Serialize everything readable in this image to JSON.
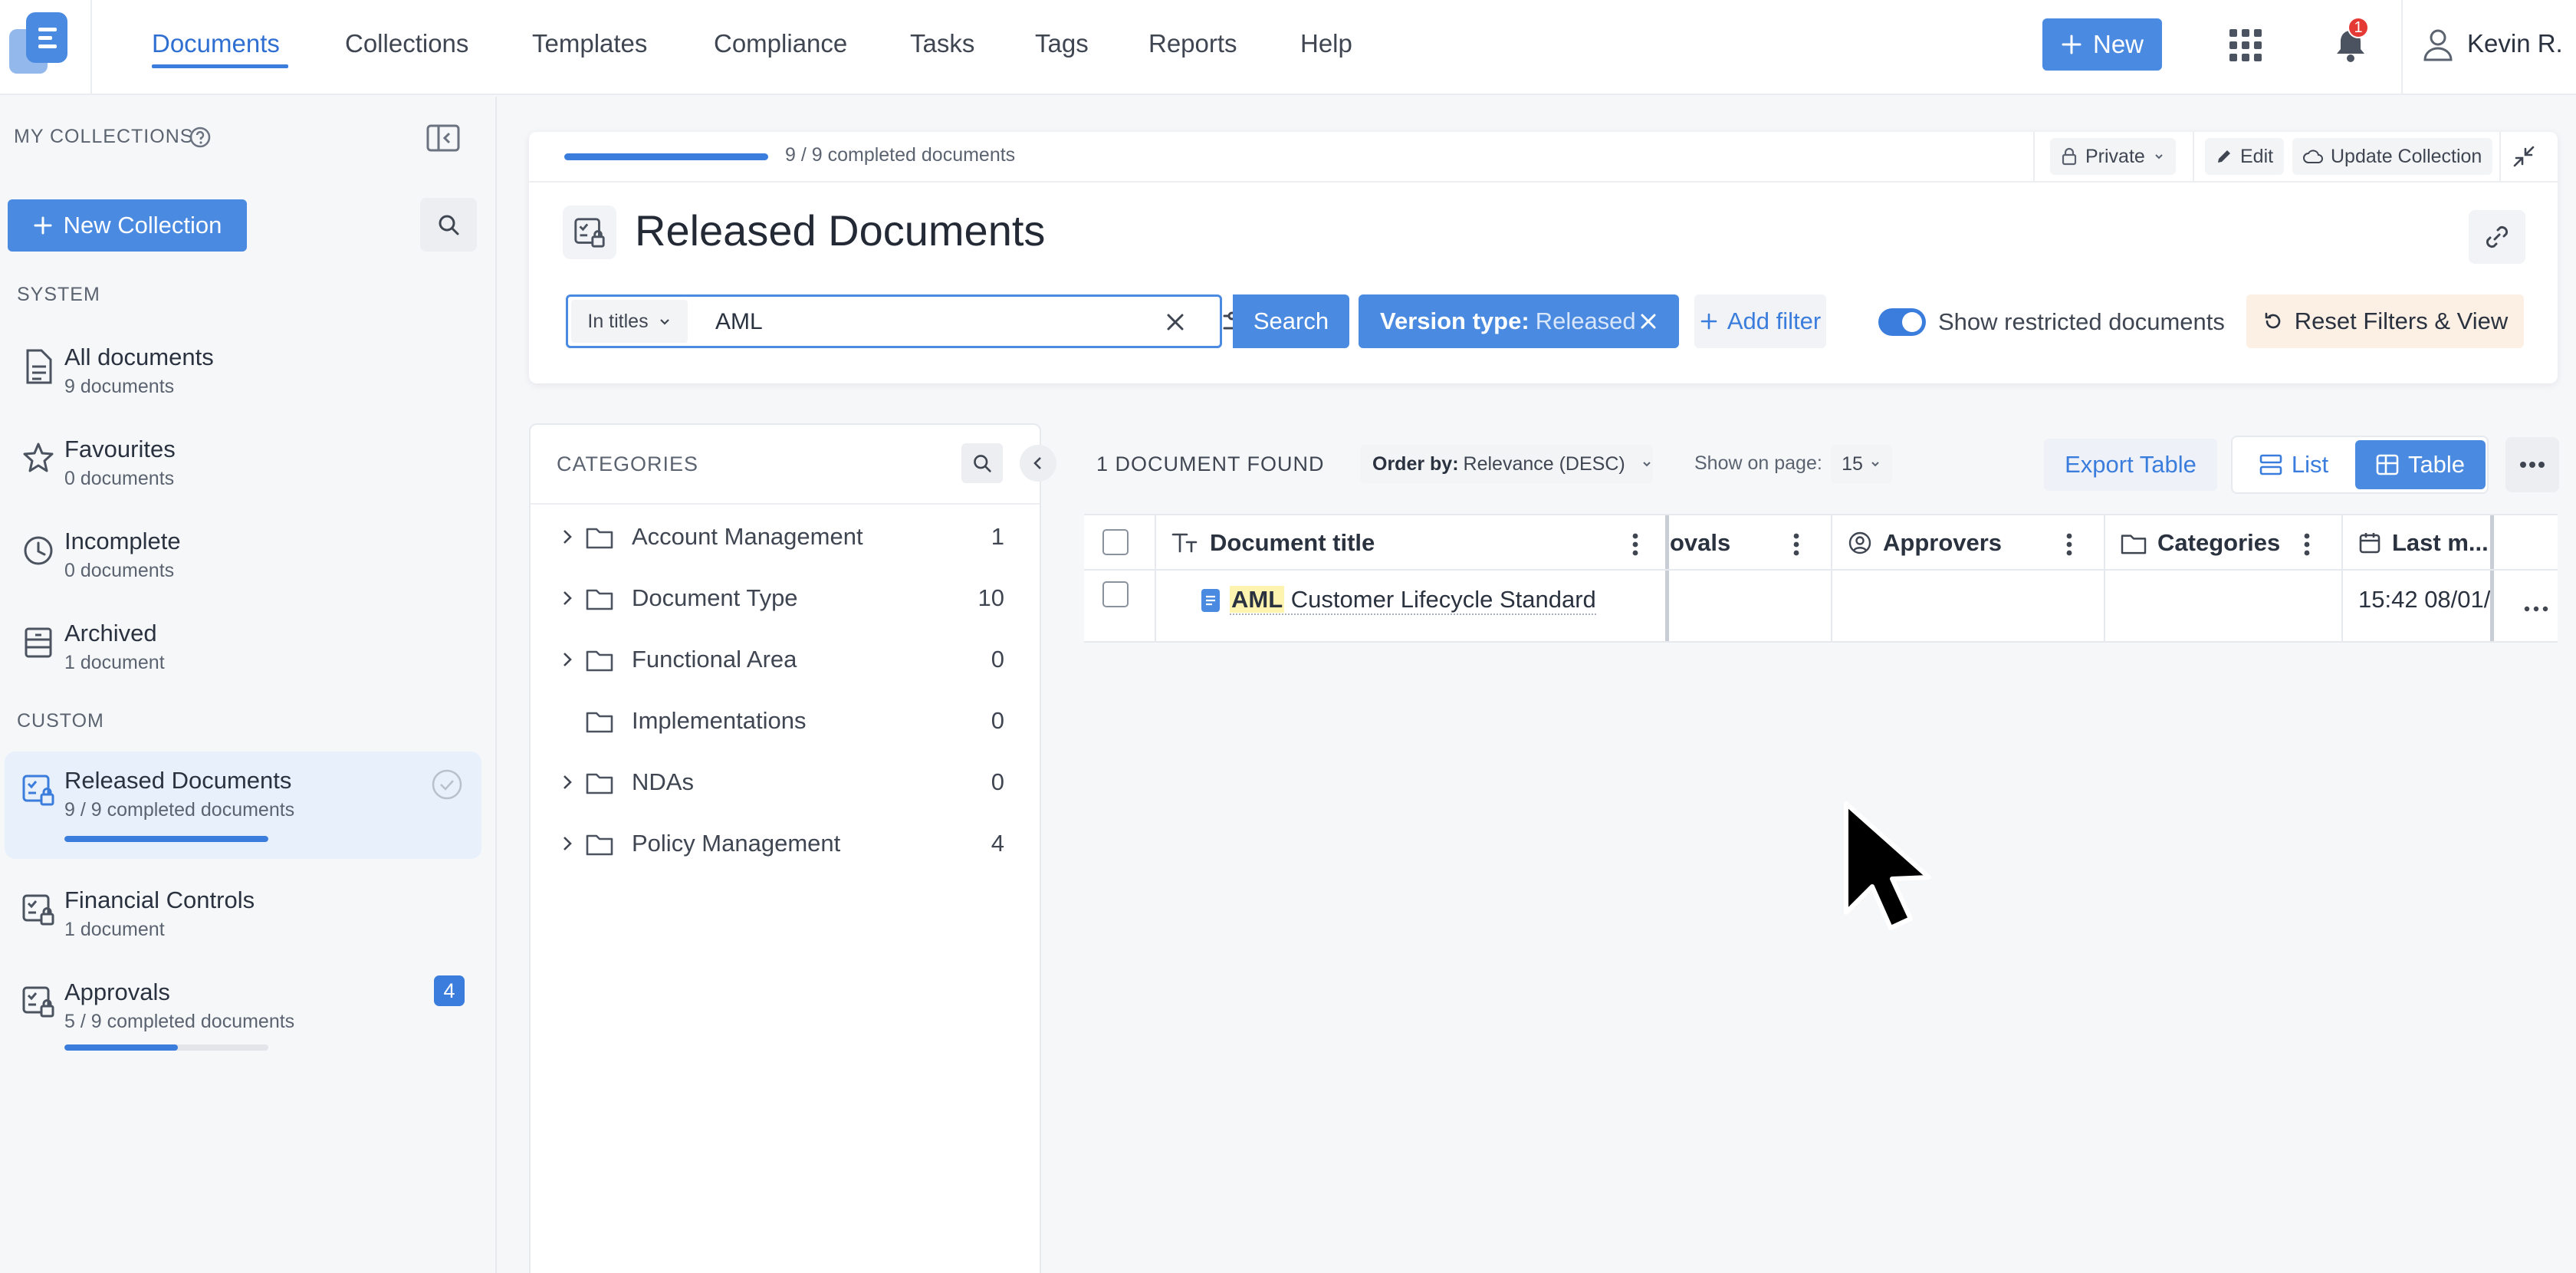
{
  "topbar": {
    "nav": [
      "Documents",
      "Collections",
      "Templates",
      "Compliance",
      "Tasks",
      "Tags",
      "Reports",
      "Help"
    ],
    "active_nav": "Documents",
    "new_label": "New",
    "notification_count": "1",
    "user_name": "Kevin R."
  },
  "sidebar": {
    "my_collections_label": "MY COLLECTIONS",
    "new_collection_label": "New Collection",
    "system_label": "SYSTEM",
    "custom_label": "CUSTOM",
    "system_items": [
      {
        "title": "All documents",
        "sub": "9 documents",
        "icon": "document-icon"
      },
      {
        "title": "Favourites",
        "sub": "0 documents",
        "icon": "star-icon"
      },
      {
        "title": "Incomplete",
        "sub": "0 documents",
        "icon": "clock-icon"
      },
      {
        "title": "Archived",
        "sub": "1 document",
        "icon": "archive-icon"
      }
    ],
    "custom_items": [
      {
        "title": "Released Documents",
        "sub": "9 / 9 completed documents",
        "progress": 1.0,
        "active": true
      },
      {
        "title": "Financial Controls",
        "sub": "1 document"
      },
      {
        "title": "Approvals",
        "sub": "5 / 9 completed documents",
        "progress": 0.5556,
        "badge": "4"
      }
    ]
  },
  "header": {
    "progress_text": "9 / 9  completed documents",
    "progress": 1.0,
    "privacy_label": "Private",
    "edit_label": "Edit",
    "update_label": "Update Collection",
    "title": "Released Documents"
  },
  "search": {
    "scope": "In titles",
    "query": "AML",
    "button_label": "Search",
    "filter_key": "Version type:",
    "filter_value": "Released",
    "add_filter_label": "Add filter",
    "toggle_label": "Show restricted documents",
    "toggle_on": true,
    "reset_label": "Reset Filters & View"
  },
  "categories": {
    "heading": "CATEGORIES",
    "items": [
      {
        "name": "Account Management",
        "count": "1",
        "expandable": true
      },
      {
        "name": "Document Type",
        "count": "10",
        "expandable": true
      },
      {
        "name": "Functional Area",
        "count": "0",
        "expandable": true
      },
      {
        "name": "Implementations",
        "count": "0",
        "expandable": false
      },
      {
        "name": "NDAs",
        "count": "0",
        "expandable": true
      },
      {
        "name": "Policy Management",
        "count": "4",
        "expandable": true
      }
    ]
  },
  "results": {
    "count_label": "1 DOCUMENT FOUND",
    "order_key": "Order by:",
    "order_value": "Relevance (DESC)",
    "show_label": "Show on page:",
    "page_size": "15",
    "export_label": "Export Table",
    "list_label": "List",
    "table_label": "Table"
  },
  "table": {
    "columns": [
      "Document title",
      "ovals",
      "Approvers",
      "Categories",
      "Last m..."
    ],
    "rows": [
      {
        "title_highlight": "AML",
        "title_rest": "Customer Lifecycle Standard",
        "last_modified": "15:42 08/01/"
      }
    ]
  },
  "colors": {
    "accent": "#3b7ddd",
    "button": "#4a8ae0",
    "badge_red": "#e53935",
    "reset_bg": "#fcefe4"
  }
}
